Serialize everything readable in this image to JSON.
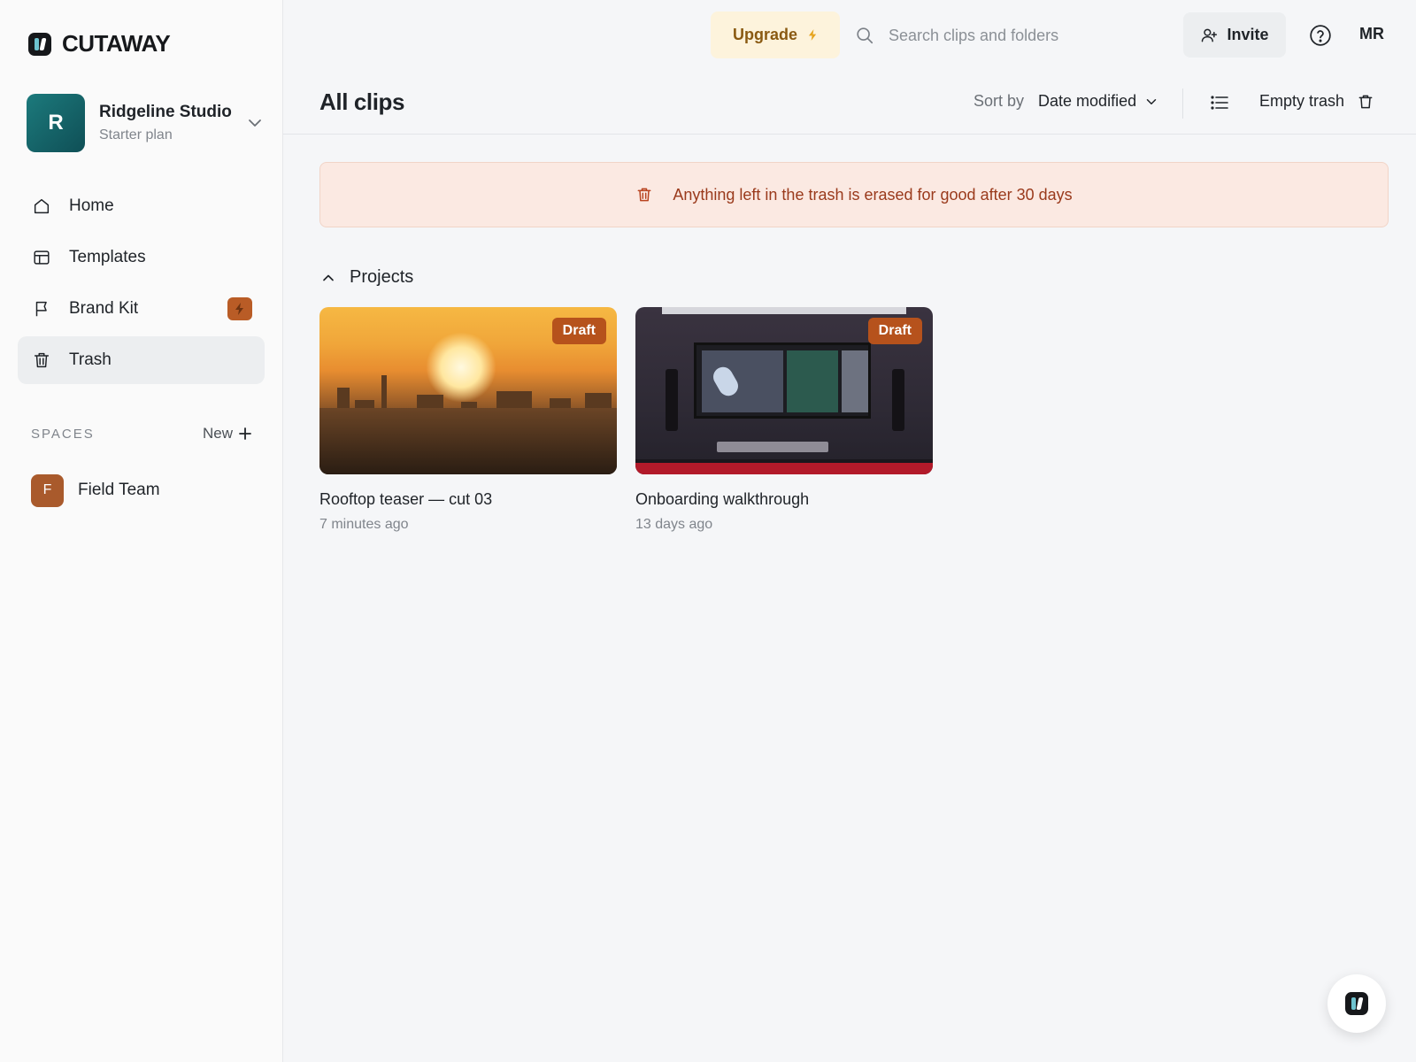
{
  "app": {
    "name": "CUTAWAY"
  },
  "workspace": {
    "initial": "R",
    "name": "Ridgeline Studio",
    "plan": "Starter plan"
  },
  "sidebar": {
    "items": [
      {
        "label": "Home",
        "icon": "home-icon"
      },
      {
        "label": "Templates",
        "icon": "templates-icon"
      },
      {
        "label": "Brand Kit",
        "icon": "flag-icon",
        "badge_icon": "lightning-icon"
      },
      {
        "label": "Trash",
        "icon": "trash-icon",
        "active": true
      }
    ],
    "spaces_title": "SPACES",
    "new_label": "New",
    "spaces": [
      {
        "initial": "F",
        "name": "Field Team"
      }
    ]
  },
  "topbar": {
    "upgrade_label": "Upgrade",
    "search_placeholder": "Search clips and folders",
    "invite_label": "Invite",
    "user_initials": "MR"
  },
  "header": {
    "title": "All clips",
    "sort_label": "Sort by",
    "sort_value": "Date modified",
    "empty_trash_label": "Empty trash"
  },
  "banner": {
    "text": "Anything left in the trash is erased for good after 30 days"
  },
  "projects": {
    "section_label": "Projects",
    "items": [
      {
        "title": "Rooftop teaser — cut 03",
        "meta": "7 minutes ago",
        "badge": "Draft"
      },
      {
        "title": "Onboarding walkthrough",
        "meta": "13 days ago",
        "badge": "Draft"
      }
    ]
  },
  "colors": {
    "accent_upgrade_bg": "#fdf3dc",
    "draft_badge": "#b6521c",
    "banner_bg": "#fbe9e2",
    "banner_text": "#9a3a1c",
    "workspace_avatar": "#156468",
    "space_avatar": "#a95a2c"
  }
}
